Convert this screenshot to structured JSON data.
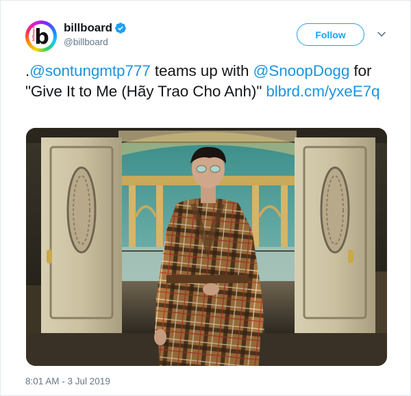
{
  "account": {
    "display_name": "billboard",
    "handle": "@billboard",
    "verified": true,
    "avatar_letter": "b",
    "avatar_wordmark": "billboard"
  },
  "header": {
    "follow_label": "Follow",
    "menu_icon": "chevron-down-icon"
  },
  "tweet": {
    "prefix": ".",
    "mention_1": "@sontungmtp777",
    "text_1": " teams up with ",
    "mention_2": "@SnoopDogg",
    "text_2": " for \"Give It to Me (Hãy Trao Cho Anh)\" ",
    "link": "blbrd.cm/yxeE7q"
  },
  "media": {
    "type": "video-still",
    "icon": "photo"
  },
  "timestamp": "8:01 AM - 3 Jul 2019",
  "colors": {
    "link": "#1b95e0",
    "follow_accent": "#1da1f2",
    "secondary_text": "#657786"
  }
}
